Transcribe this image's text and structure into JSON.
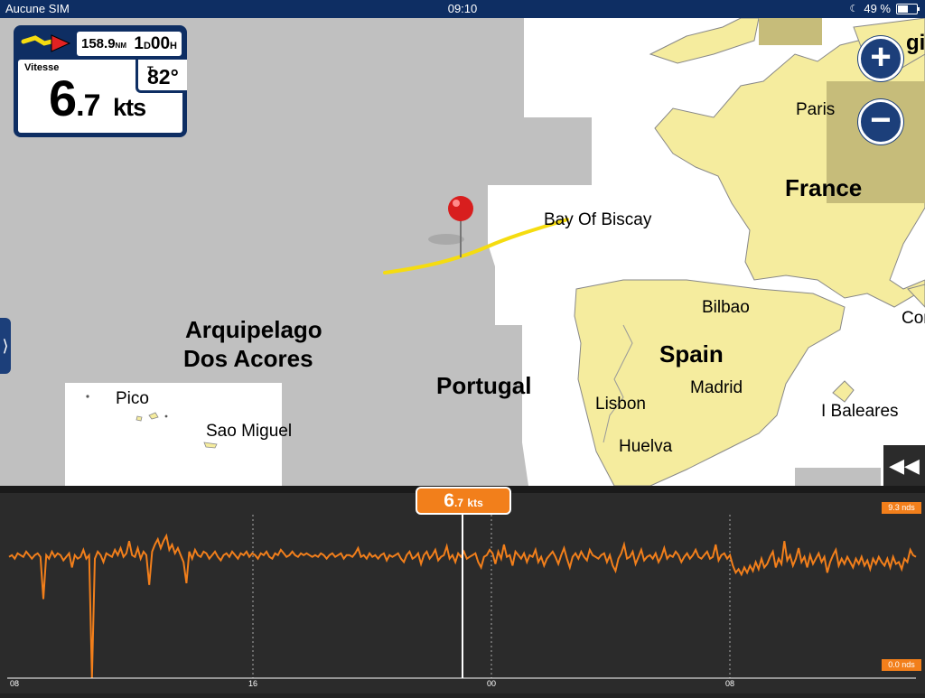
{
  "status_bar": {
    "carrier": "Aucune SIM",
    "time": "09:10",
    "battery": "49 %"
  },
  "dashboard": {
    "distance_value": "158.9",
    "distance_unit": "NM",
    "time_days": "1",
    "time_days_unit": "D",
    "time_hours": "00",
    "time_hours_unit": "H",
    "heading_value": "82°",
    "heading_unit": "T",
    "speed_label": "Vitesse",
    "speed_whole": "6",
    "speed_decimal": ".7",
    "speed_unit": "kts"
  },
  "map": {
    "labels": {
      "azores": [
        "Arquipelago",
        "Dos Acores"
      ],
      "pico": "Pico",
      "sao_miguel": "Sao Miguel",
      "portugal": "Portugal",
      "spain": "Spain",
      "france": "France",
      "paris": "Paris",
      "bay_of_biscay": "Bay Of Biscay",
      "bilbao": "Bilbao",
      "madrid": "Madrid",
      "lisbon": "Lisbon",
      "huelva": "Huelva",
      "baleares": "I Baleares",
      "cor_partial": "Cor",
      "belgium_partial": "gi"
    },
    "zoom_in": "+",
    "zoom_out": "−",
    "side_tab": "⟩",
    "collapse": "◀◀"
  },
  "colors": {
    "land": "#f5ec9e",
    "sea_shaded": "#c0c0c0",
    "sea": "#ffffff",
    "accent_orange": "#f27f1b",
    "nav_blue": "#0e2e63",
    "track": "#f5dc10"
  },
  "speed_chart": {
    "cursor_label_whole": "6",
    "cursor_label_decimal": ".7",
    "cursor_label_unit": "kts",
    "max_label": "9.3 nds",
    "min_label": "0.0 nds",
    "x_labels": [
      "08",
      "16",
      "00",
      "08"
    ]
  },
  "chart_data": {
    "type": "line",
    "title": "",
    "xlabel": "",
    "ylabel": "",
    "x_ticks": [
      "08",
      "16",
      "00",
      "08"
    ],
    "ylim": [
      0,
      9.3
    ],
    "cursor_value": 6.7,
    "series": [
      {
        "values": [
          6.9,
          7.0,
          6.8,
          7.1,
          7.0,
          6.9,
          7.2,
          7.0,
          6.8,
          7.0,
          7.1,
          6.9,
          4.5,
          7.0,
          6.8,
          7.2,
          6.9,
          7.1,
          7.0,
          6.7,
          6.9,
          7.1,
          6.3,
          7.0,
          6.8,
          6.9,
          7.3,
          6.8,
          7.0,
          0.0,
          6.8,
          7.2,
          7.0,
          6.6,
          7.1,
          7.0,
          6.9,
          7.3,
          7.0,
          7.4,
          6.9,
          7.1,
          7.8,
          7.0,
          6.9,
          7.4,
          6.8,
          7.2,
          7.0,
          5.3,
          7.2,
          7.6,
          7.9,
          7.4,
          7.8,
          8.1,
          7.3,
          7.6,
          7.1,
          7.4,
          7.0,
          6.6,
          5.4,
          7.2,
          6.8,
          7.3,
          7.0,
          6.9,
          7.2,
          7.1,
          6.8,
          7.0,
          7.2,
          6.9,
          6.7,
          7.0,
          7.1,
          6.9,
          7.2,
          7.0,
          6.8,
          7.1,
          7.0,
          7.2,
          6.9,
          7.1,
          7.0,
          6.8,
          7.1,
          7.0,
          7.2,
          6.9,
          6.8,
          7.1,
          7.0,
          7.3,
          7.1,
          6.9,
          7.0,
          7.2,
          7.0,
          6.9,
          7.1,
          7.0,
          7.1,
          7.0,
          6.9,
          7.0,
          6.9,
          7.1,
          7.0,
          6.8,
          7.0,
          7.1,
          6.9,
          7.0,
          7.1,
          6.8,
          7.0,
          7.0,
          6.9,
          7.1,
          7.4,
          6.9,
          7.0,
          6.8,
          7.1,
          6.9,
          7.0,
          6.8,
          7.0,
          7.1,
          6.7,
          7.0,
          6.9,
          7.0,
          7.1,
          6.8,
          6.6,
          7.0,
          7.2,
          6.8,
          6.9,
          7.1,
          6.5,
          7.0,
          7.2,
          6.8,
          7.0,
          7.3,
          6.7,
          6.9,
          7.0,
          7.5,
          6.8,
          7.0,
          6.6,
          7.1,
          6.9,
          7.2,
          6.8,
          6.9,
          7.0,
          7.1,
          6.6,
          6.3,
          6.9,
          7.0,
          7.3,
          7.1,
          6.5,
          7.2,
          6.8,
          7.6,
          6.9,
          7.0,
          6.4,
          7.2,
          7.0,
          6.8,
          7.1,
          6.6,
          7.0,
          6.9,
          7.3,
          6.6,
          6.9,
          6.4,
          6.8,
          7.0,
          7.2,
          6.9,
          6.5,
          7.0,
          7.4,
          6.8,
          6.3,
          6.9,
          7.1,
          6.8,
          7.2,
          6.9,
          6.7,
          7.3,
          7.0,
          6.9,
          6.8,
          7.0,
          7.1,
          6.6,
          7.0,
          6.4,
          6.1,
          6.8,
          7.1,
          7.6,
          6.8,
          6.9,
          7.2,
          6.5,
          6.9,
          7.3,
          6.7,
          6.9,
          7.0,
          6.8,
          7.1,
          6.6,
          6.9,
          7.4,
          6.8,
          7.0,
          6.9,
          7.2,
          7.0,
          6.6,
          6.9,
          7.1,
          6.8,
          7.0,
          7.3,
          6.9,
          6.8,
          7.0,
          7.2,
          6.8,
          6.9,
          7.6,
          6.7,
          7.0,
          7.1,
          6.8,
          7.0,
          6.4,
          6.0,
          6.2,
          5.9,
          6.3,
          6.0,
          6.4,
          6.1,
          6.6,
          6.2,
          6.8,
          6.3,
          6.5,
          6.9,
          7.2,
          6.3,
          6.8,
          6.5,
          7.8,
          6.7,
          7.0,
          6.4,
          6.8,
          7.4,
          6.6,
          6.9,
          6.3,
          7.0,
          6.5,
          6.8,
          7.1,
          6.6,
          6.9,
          6.0,
          6.6,
          7.0,
          7.3,
          6.4,
          6.8,
          6.5,
          6.9,
          6.6,
          6.3,
          6.8,
          6.5,
          6.9,
          6.4,
          6.7,
          6.2,
          6.8,
          6.5,
          6.9,
          6.6,
          6.4,
          6.8,
          6.3,
          6.9,
          6.5,
          6.6,
          6.2,
          6.8,
          6.6,
          7.3,
          7.0,
          6.9
        ]
      }
    ]
  }
}
